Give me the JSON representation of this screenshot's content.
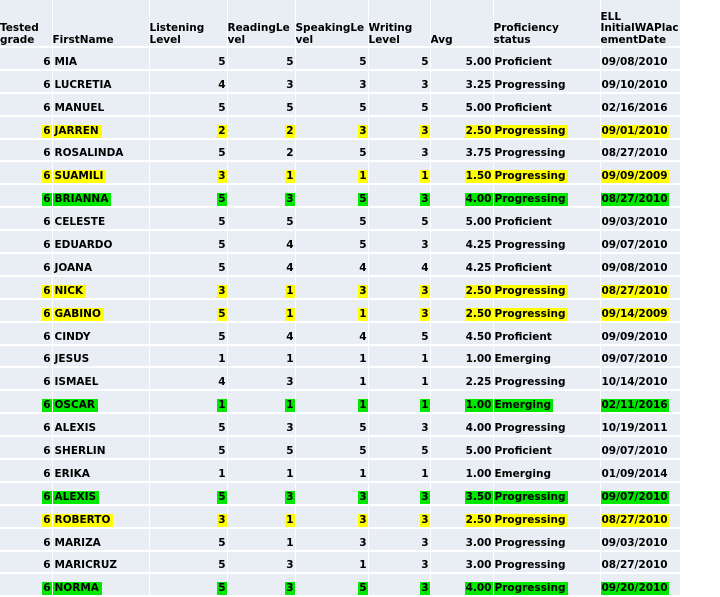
{
  "table": {
    "columns": [
      {
        "key": "grade",
        "label": "Tested grade",
        "align": "right"
      },
      {
        "key": "name",
        "label": "FirstName",
        "align": "left"
      },
      {
        "key": "listen",
        "label": "Listening Level",
        "align": "right"
      },
      {
        "key": "read",
        "label": "ReadingLevel",
        "align": "right"
      },
      {
        "key": "speak",
        "label": "SpeakingLevel",
        "align": "right"
      },
      {
        "key": "write",
        "label": "Writing Level",
        "align": "right"
      },
      {
        "key": "avg",
        "label": "Avg",
        "align": "right"
      },
      {
        "key": "prof",
        "label": "Proficiency status",
        "align": "left"
      },
      {
        "key": "date",
        "label": "ELL InitialWAPlacementDate",
        "align": "left"
      }
    ],
    "rows": [
      {
        "grade": "6",
        "name": "MIA",
        "listen": "5",
        "read": "5",
        "speak": "5",
        "write": "5",
        "avg": "5.00",
        "prof": "Proficient",
        "date": "09/08/2010",
        "highlight": "none"
      },
      {
        "grade": "6",
        "name": "LUCRETIA",
        "listen": "4",
        "read": "3",
        "speak": "3",
        "write": "3",
        "avg": "3.25",
        "prof": "Progressing",
        "date": "09/10/2010",
        "highlight": "none"
      },
      {
        "grade": "6",
        "name": "MANUEL",
        "listen": "5",
        "read": "5",
        "speak": "5",
        "write": "5",
        "avg": "5.00",
        "prof": "Proficient",
        "date": "02/16/2016",
        "highlight": "none"
      },
      {
        "grade": "6",
        "name": "JARREN",
        "listen": "2",
        "read": "2",
        "speak": "3",
        "write": "3",
        "avg": "2.50",
        "prof": "Progressing",
        "date": "09/01/2010",
        "highlight": "yellow"
      },
      {
        "grade": "6",
        "name": "ROSALINDA",
        "listen": "5",
        "read": "2",
        "speak": "5",
        "write": "3",
        "avg": "3.75",
        "prof": "Progressing",
        "date": "08/27/2010",
        "highlight": "none"
      },
      {
        "grade": "6",
        "name": "SUAMILI",
        "listen": "3",
        "read": "1",
        "speak": "1",
        "write": "1",
        "avg": "1.50",
        "prof": "Progressing",
        "date": "09/09/2009",
        "highlight": "yellow"
      },
      {
        "grade": "6",
        "name": "BRIANNA",
        "listen": "5",
        "read": "3",
        "speak": "5",
        "write": "3",
        "avg": "4.00",
        "prof": "Progressing",
        "date": "08/27/2010",
        "highlight": "green"
      },
      {
        "grade": "6",
        "name": "CELESTE",
        "listen": "5",
        "read": "5",
        "speak": "5",
        "write": "5",
        "avg": "5.00",
        "prof": "Proficient",
        "date": "09/03/2010",
        "highlight": "none"
      },
      {
        "grade": "6",
        "name": "EDUARDO",
        "listen": "5",
        "read": "4",
        "speak": "5",
        "write": "3",
        "avg": "4.25",
        "prof": "Progressing",
        "date": "09/07/2010",
        "highlight": "none"
      },
      {
        "grade": "6",
        "name": "JOANA",
        "listen": "5",
        "read": "4",
        "speak": "4",
        "write": "4",
        "avg": "4.25",
        "prof": "Proficient",
        "date": "09/08/2010",
        "highlight": "none"
      },
      {
        "grade": "6",
        "name": "NICK",
        "listen": "3",
        "read": "1",
        "speak": "3",
        "write": "3",
        "avg": "2.50",
        "prof": "Progressing",
        "date": "08/27/2010",
        "highlight": "yellow"
      },
      {
        "grade": "6",
        "name": "GABINO",
        "listen": "5",
        "read": "1",
        "speak": "1",
        "write": "3",
        "avg": "2.50",
        "prof": "Progressing",
        "date": "09/14/2009",
        "highlight": "yellow"
      },
      {
        "grade": "6",
        "name": "CINDY",
        "listen": "5",
        "read": "4",
        "speak": "4",
        "write": "5",
        "avg": "4.50",
        "prof": "Proficient",
        "date": "09/09/2010",
        "highlight": "none"
      },
      {
        "grade": "6",
        "name": "JESUS",
        "listen": "1",
        "read": "1",
        "speak": "1",
        "write": "1",
        "avg": "1.00",
        "prof": "Emerging",
        "date": "09/07/2010",
        "highlight": "none"
      },
      {
        "grade": "6",
        "name": "ISMAEL",
        "listen": "4",
        "read": "3",
        "speak": "1",
        "write": "1",
        "avg": "2.25",
        "prof": "Progressing",
        "date": "10/14/2010",
        "highlight": "none"
      },
      {
        "grade": "6",
        "name": "OSCAR",
        "listen": "1",
        "read": "1",
        "speak": "1",
        "write": "1",
        "avg": "1.00",
        "prof": "Emerging",
        "date": "02/11/2016",
        "highlight": "green"
      },
      {
        "grade": "6",
        "name": "ALEXIS",
        "listen": "5",
        "read": "3",
        "speak": "5",
        "write": "3",
        "avg": "4.00",
        "prof": "Progressing",
        "date": "10/19/2011",
        "highlight": "none"
      },
      {
        "grade": "6",
        "name": "SHERLIN",
        "listen": "5",
        "read": "5",
        "speak": "5",
        "write": "5",
        "avg": "5.00",
        "prof": "Proficient",
        "date": "09/07/2010",
        "highlight": "none"
      },
      {
        "grade": "6",
        "name": "ERIKA",
        "listen": "1",
        "read": "1",
        "speak": "1",
        "write": "1",
        "avg": "1.00",
        "prof": "Emerging",
        "date": "01/09/2014",
        "highlight": "none"
      },
      {
        "grade": "6",
        "name": "ALEXIS",
        "listen": "5",
        "read": "3",
        "speak": "3",
        "write": "3",
        "avg": "3.50",
        "prof": "Progressing",
        "date": "09/07/2010",
        "highlight": "green"
      },
      {
        "grade": "6",
        "name": "ROBERTO",
        "listen": "3",
        "read": "1",
        "speak": "3",
        "write": "3",
        "avg": "2.50",
        "prof": "Progressing",
        "date": "08/27/2010",
        "highlight": "yellow"
      },
      {
        "grade": "6",
        "name": "MARIZA",
        "listen": "5",
        "read": "1",
        "speak": "3",
        "write": "3",
        "avg": "3.00",
        "prof": "Progressing",
        "date": "09/03/2010",
        "highlight": "none"
      },
      {
        "grade": "6",
        "name": "MARICRUZ",
        "listen": "5",
        "read": "3",
        "speak": "1",
        "write": "3",
        "avg": "3.00",
        "prof": "Progressing",
        "date": "08/27/2010",
        "highlight": "none"
      },
      {
        "grade": "6",
        "name": "NORMA",
        "listen": "5",
        "read": "3",
        "speak": "5",
        "write": "3",
        "avg": "4.00",
        "prof": "Progressing",
        "date": "09/20/2010",
        "highlight": "green"
      }
    ]
  },
  "colors": {
    "cell_background": "#e9edf4",
    "gridline": "#ffffff",
    "highlight_yellow": "#ffff00",
    "highlight_green": "#00e800",
    "text": "#000000"
  }
}
